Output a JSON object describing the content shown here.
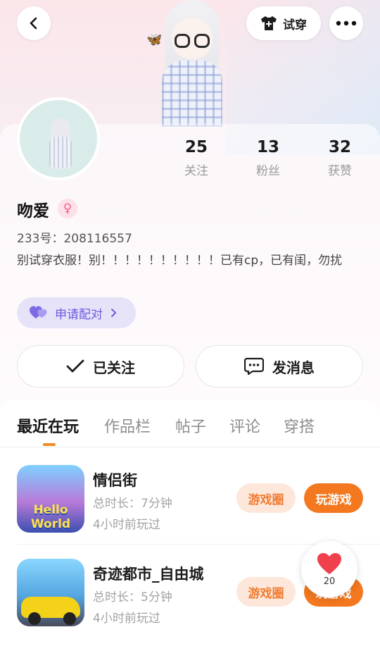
{
  "header": {
    "tryon_label": "试穿"
  },
  "profile": {
    "name": "吻爱",
    "gender_symbol": "♀",
    "uid": "233号：208116557",
    "bio": "别试穿衣服！别！！！！！！！！！！已有cp，已有闺，勿扰",
    "pair_label": "申请配对"
  },
  "stats": [
    {
      "value": "25",
      "label": "关注"
    },
    {
      "value": "13",
      "label": "粉丝"
    },
    {
      "value": "32",
      "label": "获赞"
    }
  ],
  "actions": {
    "follow_label": "已关注",
    "message_label": "发消息"
  },
  "tabs": [
    {
      "label": "最近在玩"
    },
    {
      "label": "作品栏"
    },
    {
      "label": "帖子"
    },
    {
      "label": "评论"
    },
    {
      "label": "穿搭"
    }
  ],
  "games": [
    {
      "title": "情侣街",
      "duration": "总时长：7分钟",
      "last_played": "4小时前玩过",
      "icon_text": "Hello World",
      "circle_label": "游戏圈",
      "play_label": "玩游戏"
    },
    {
      "title": "奇迹都市_自由城",
      "duration": "总时长：5分钟",
      "last_played": "4小时前玩过",
      "circle_label": "游戏圈",
      "play_label": "玩游戏"
    }
  ],
  "like_fab": {
    "count": "20"
  },
  "colors": {
    "accent_orange": "#f3781f",
    "pair_purple": "#6c5ce0",
    "gender_pink": "#f0608a"
  }
}
